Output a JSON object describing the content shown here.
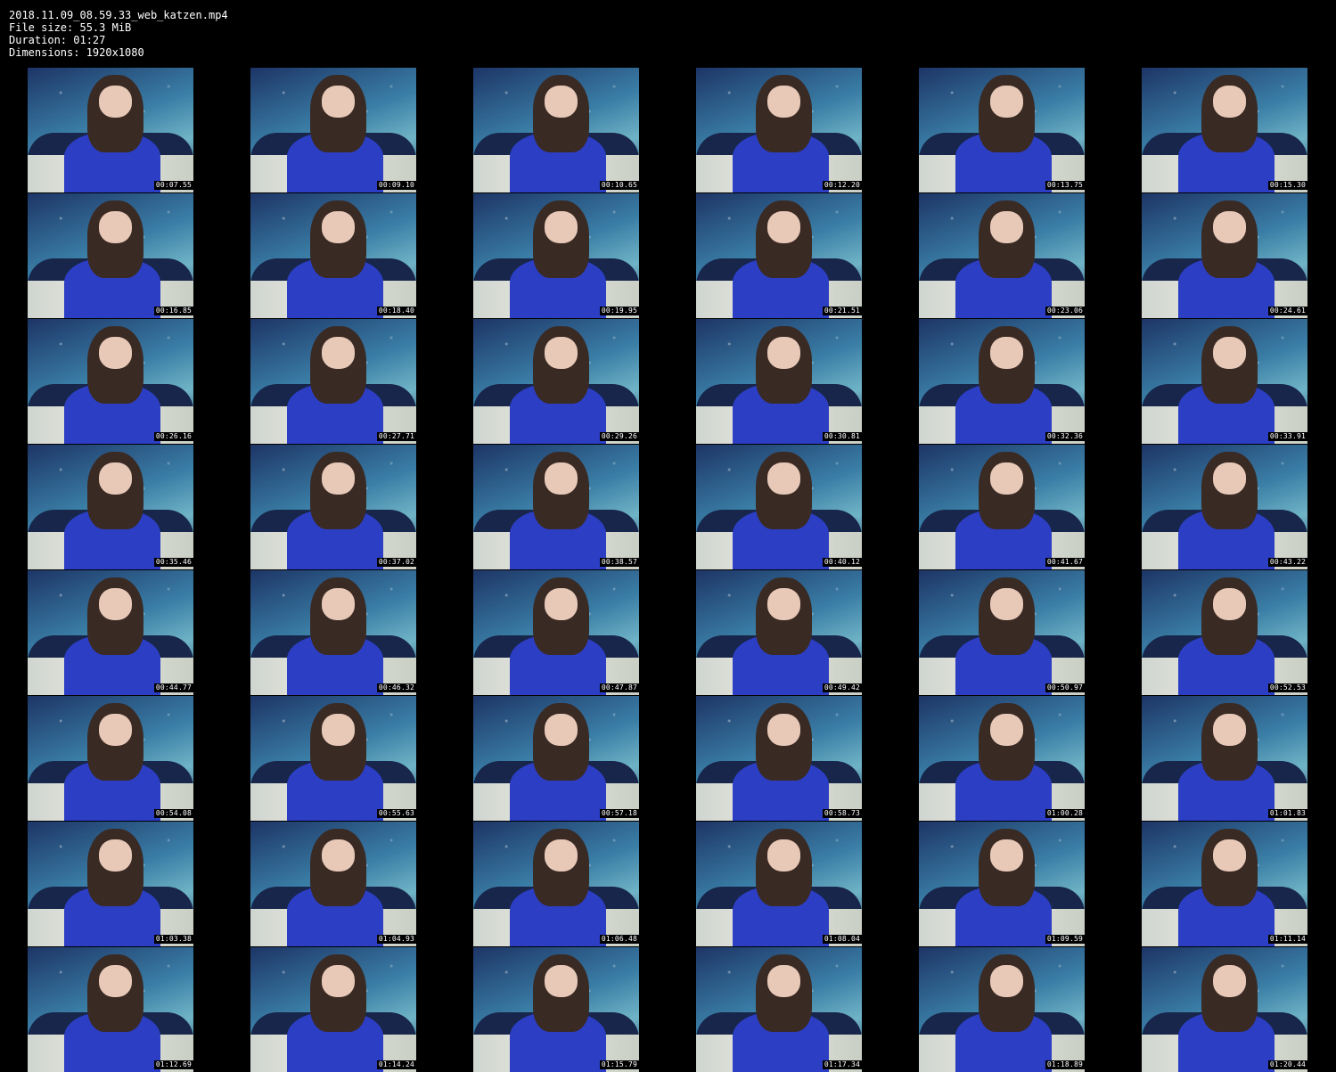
{
  "header": {
    "filename": "2018.11.09_08.59.33_web_katzen.mp4",
    "file_size": "File size: 55.3 MiB",
    "duration": "Duration: 01:27",
    "dimensions": "Dimensions: 1920x1080"
  },
  "thumbnails": [
    "00:07.55",
    "00:09.10",
    "00:10.65",
    "00:12.20",
    "00:13.75",
    "00:15.30",
    "00:16.85",
    "00:18.40",
    "00:19.95",
    "00:21.51",
    "00:23.06",
    "00:24.61",
    "00:26.16",
    "00:27.71",
    "00:29.26",
    "00:30.81",
    "00:32.36",
    "00:33.91",
    "00:35.46",
    "00:37.02",
    "00:38.57",
    "00:40.12",
    "00:41.67",
    "00:43.22",
    "00:44.77",
    "00:46.32",
    "00:47.87",
    "00:49.42",
    "00:50.97",
    "00:52.53",
    "00:54.08",
    "00:55.63",
    "00:57.18",
    "00:58.73",
    "01:00.28",
    "01:01.83",
    "01:03.38",
    "01:04.93",
    "01:06.48",
    "01:08.04",
    "01:09.59",
    "01:11.14",
    "01:12.69",
    "01:14.24",
    "01:15.79",
    "01:17.34",
    "01:18.89",
    "01:20.44"
  ],
  "colors": {
    "background": "#000000",
    "text": "#ffffff",
    "shirt": "#2c3ec4"
  }
}
